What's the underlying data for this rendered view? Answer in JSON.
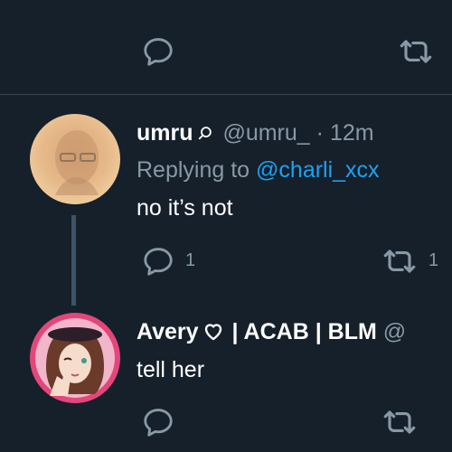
{
  "colors": {
    "background": "#15202b",
    "divider": "#38444d",
    "muted": "#8899a6",
    "link": "#1da1f2",
    "text": "#ffffff"
  },
  "top_tweet": {
    "icons": [
      "reply-icon",
      "retweet-icon"
    ]
  },
  "tweet_umru": {
    "display_name": "umru",
    "handle": "@umru_",
    "separator": "·",
    "time": "12m",
    "replying_prefix": "Replying to",
    "replying_to": "@charli_xcx",
    "text": "no it’s not",
    "reply_count": "1",
    "retweet_count": "1",
    "icons": [
      "search-icon",
      "reply-icon",
      "retweet-icon"
    ]
  },
  "tweet_avery": {
    "display_name_prefix": "Avery",
    "display_name_suffix": " | ACAB | BLM",
    "handle_fragment": "@",
    "text": "tell her",
    "icons": [
      "heart-outline-icon",
      "reply-icon",
      "retweet-icon"
    ]
  }
}
